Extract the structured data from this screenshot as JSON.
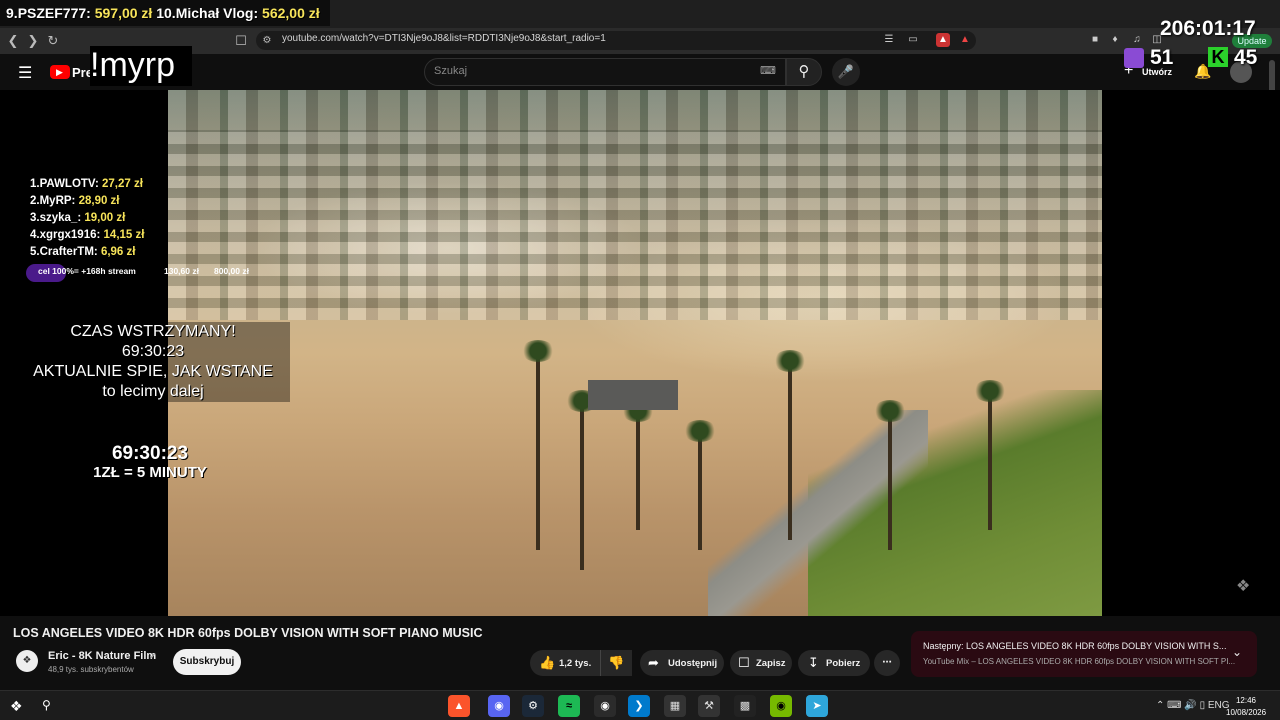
{
  "overlay": {
    "top_ticker": [
      {
        "rank": "9.",
        "name": "PSZEF777:",
        "amount": "597,00 zł"
      },
      {
        "rank": "10.",
        "name": "Michał Vlog:",
        "amount": "562,00 zł"
      }
    ],
    "channel_tag": "!myrp",
    "timer_top": "206:01:17",
    "twitch_viewers": "51",
    "kick_viewers": "45",
    "kick_logo": "K",
    "leaderboard": [
      {
        "rank": "1.",
        "name": "PAWLOTV:",
        "amount": "27,27 zł"
      },
      {
        "rank": "2.",
        "name": "MyRP:",
        "amount": "28,90 zł"
      },
      {
        "rank": "3.",
        "name": "szyka_:",
        "amount": "19,00 zł"
      },
      {
        "rank": "4.",
        "name": "xgrgx1916:",
        "amount": "14,15 zł"
      },
      {
        "rank": "5.",
        "name": "CrafterTM:",
        "amount": "6,96 zł"
      }
    ],
    "goal_label": "cel 100%= +168h stream",
    "goal_current": "130,60 zł",
    "goal_target": "800,00 zł",
    "goal_fill": 0.16,
    "pause": [
      "CZAS WSTRZYMANY!",
      "69:30:23",
      "AKTUALNIE SPIE, JAK WSTANE",
      "to lecimy dalej"
    ],
    "big_timer": "69:30:23",
    "rate": "1ZŁ = 5 MINUTY"
  },
  "browser": {
    "url": "youtube.com/watch?v=DTI3Nje9oJ8&list=RDDTI3Nje9oJ8&start_radio=1",
    "update_badge": "Update"
  },
  "youtube": {
    "logo_text": "Prem",
    "search_placeholder": "Szukaj",
    "create_label": "Utwórz",
    "video_title": "LOS ANGELES VIDEO 8K HDR 60fps DOLBY VISION WITH SOFT PIANO MUSIC",
    "channel_name": "Eric - 8K Nature Film",
    "channel_subs": "48,9 tys. subskrybentów",
    "subscribe_label": "Subskrybuj",
    "like_count": "1,2 tys.",
    "share_label": "Udostępnij",
    "save_label": "Zapisz",
    "download_label": "Pobierz",
    "next_title": "Następny: LOS ANGELES VIDEO 8K HDR 60fps DOLBY VISION WITH S...",
    "next_sub": "YouTube Mix – LOS ANGELES VIDEO 8K HDR 60fps DOLBY VISION WITH SOFT PI..."
  },
  "taskbar": {
    "lang": "ENG",
    "time": "12:46",
    "date": "10/08/2026"
  },
  "colors": {
    "accent_yellow": "#f7e45a",
    "twitch": "#8a4bd4",
    "kick": "#2bd12b",
    "youtube_red": "#ff0000"
  }
}
